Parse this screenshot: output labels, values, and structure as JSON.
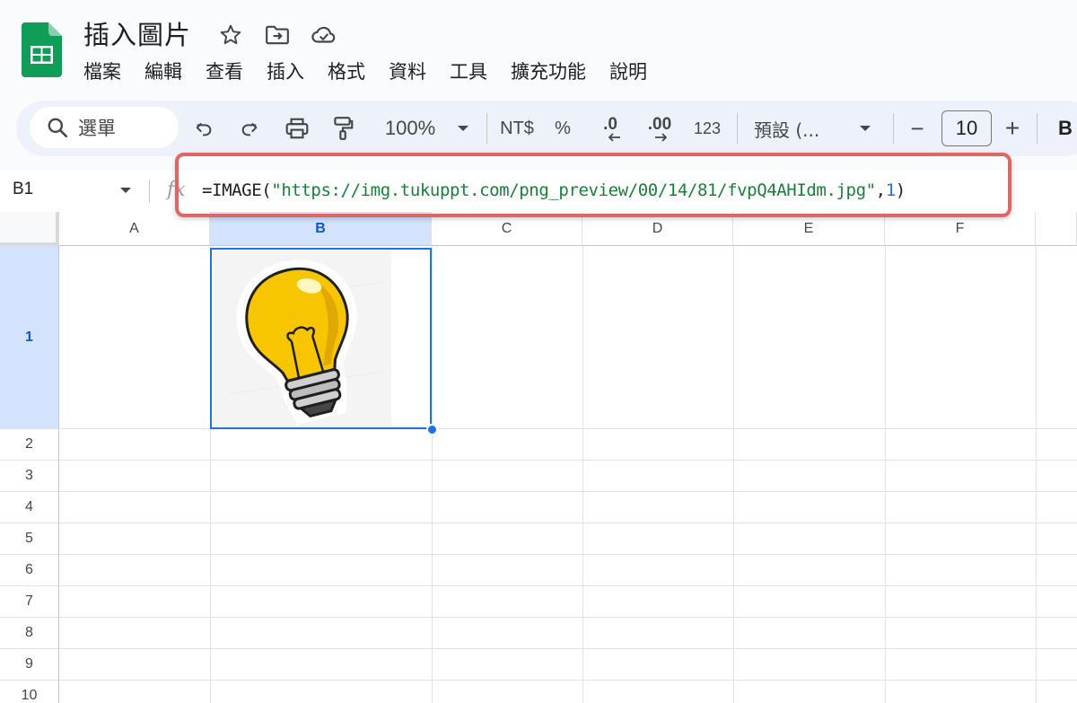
{
  "app": {
    "title": "插入圖片",
    "icons": [
      "star-icon",
      "move-to-folder-icon",
      "cloud-saved-icon"
    ],
    "menu": [
      "檔案",
      "編輯",
      "查看",
      "插入",
      "格式",
      "資料",
      "工具",
      "擴充功能",
      "說明"
    ]
  },
  "toolbar": {
    "search_label": "選單",
    "zoom": "100%",
    "currency": "NT$",
    "percent": "%",
    "decimal_decrease": ".0",
    "decimal_increase": ".00",
    "number_format": "123",
    "font_name": "預設 (...",
    "font_size": "10",
    "minus": "−",
    "plus": "+",
    "bold": "B"
  },
  "formula_bar": {
    "cell_ref": "B1",
    "fx": "fx",
    "formula_prefix": "=IMAGE(",
    "formula_url": "\"https://img.tukuppt.com/png_preview/00/14/81/fvpQ4AHIdm.jpg\"",
    "formula_sep": ",",
    "formula_mode": "1",
    "formula_suffix": ")"
  },
  "grid": {
    "columns": [
      "A",
      "B",
      "C",
      "D",
      "E",
      "F"
    ],
    "selected_column": "B",
    "rows": [
      "1",
      "2",
      "3",
      "4",
      "5",
      "6",
      "7",
      "8",
      "9",
      "10"
    ],
    "selected_row": "1",
    "cell_b1_image": "lightbulb-image"
  },
  "colors": {
    "accent": "#1a73e8",
    "highlight_border": "#e06666",
    "selected_header_bg": "#d3e3fd",
    "bulb_yellow": "#f7c600",
    "sheets_green": "#0f9d58"
  }
}
